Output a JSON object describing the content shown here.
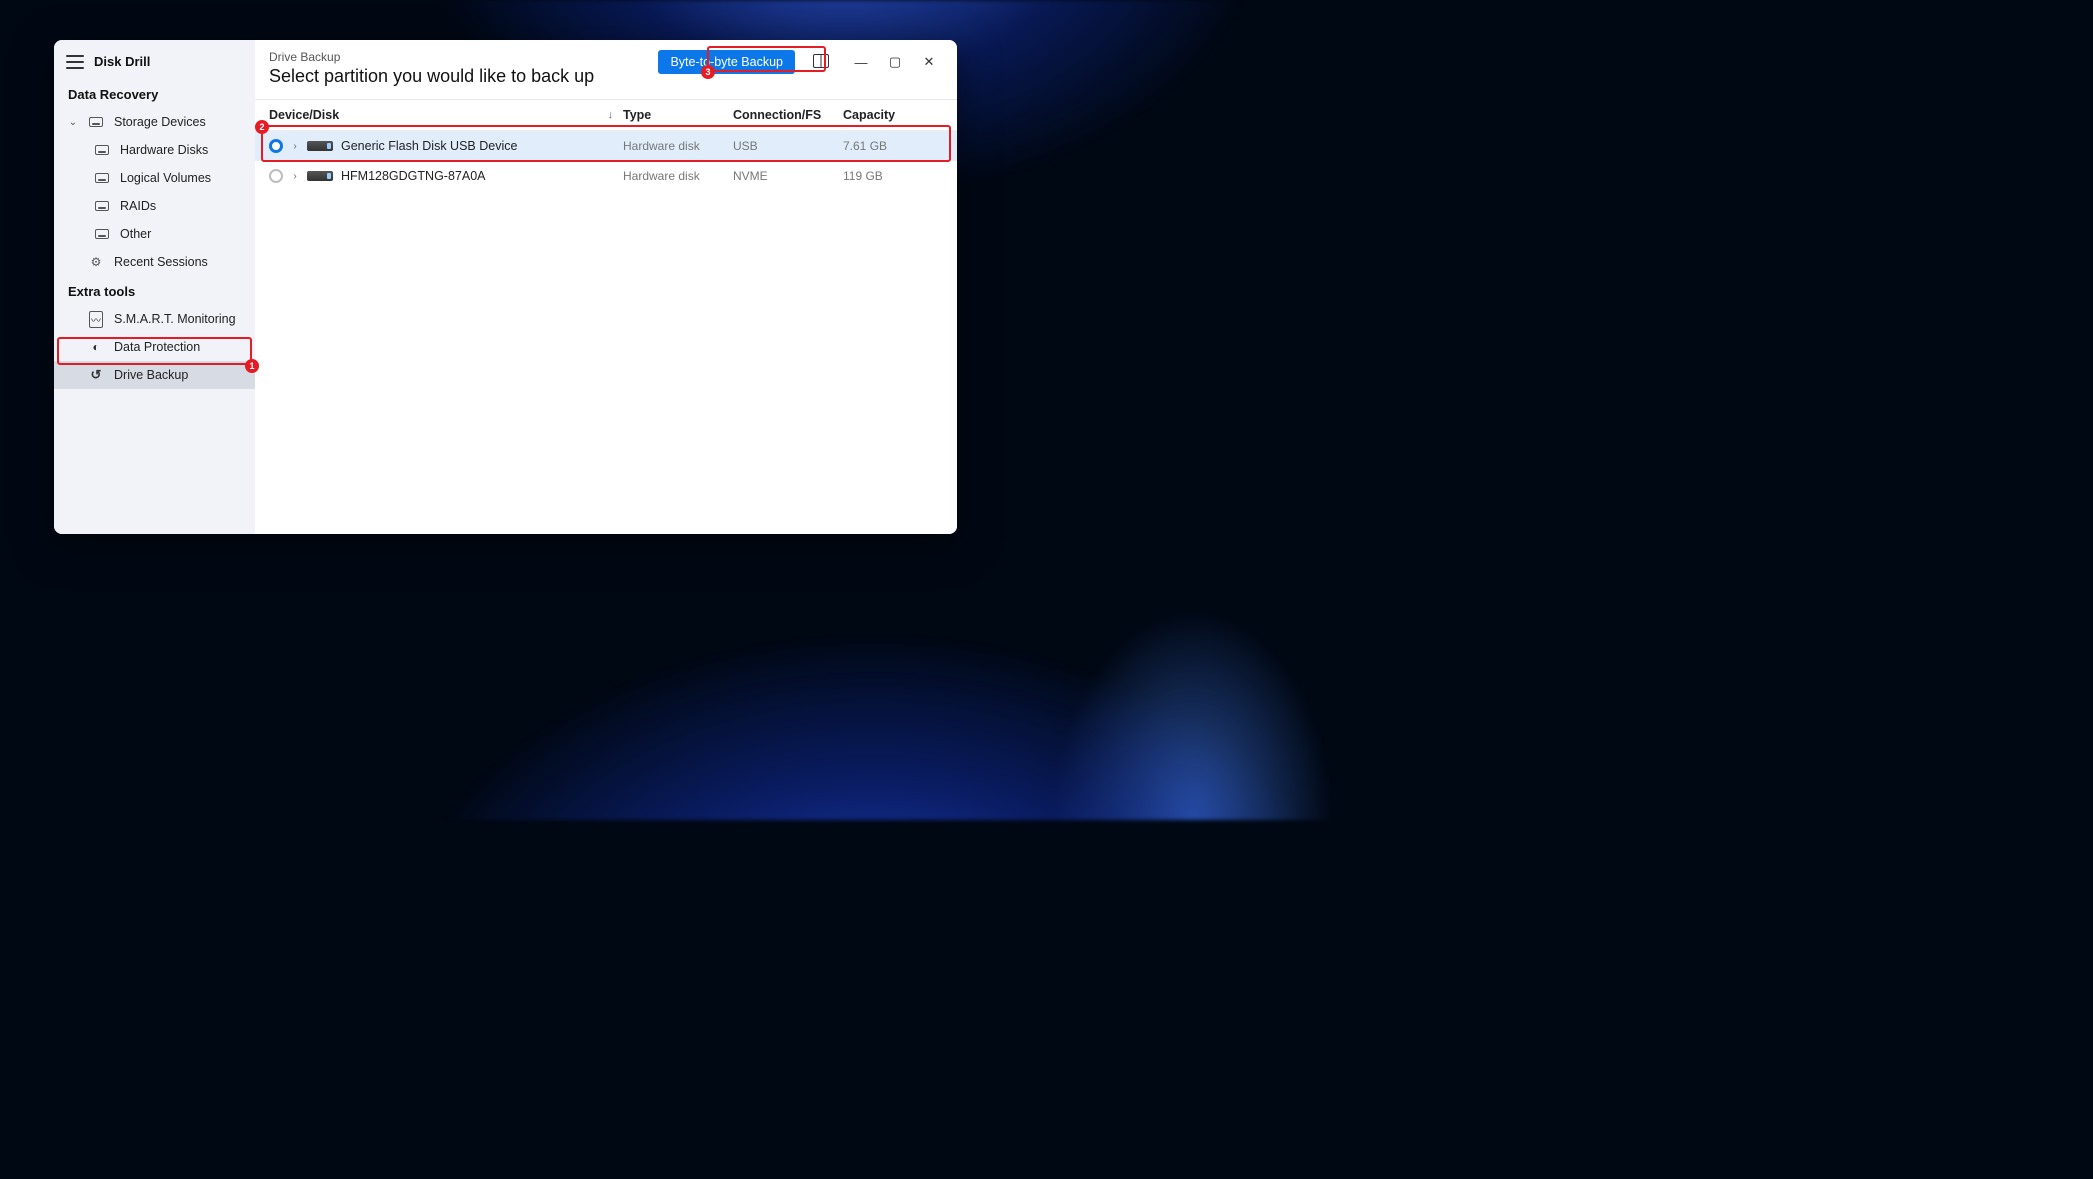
{
  "app": {
    "title": "Disk Drill"
  },
  "sidebar": {
    "sections": [
      {
        "label": "Data Recovery",
        "items": [
          {
            "label": "Storage Devices",
            "expandable": true
          },
          {
            "label": "Hardware Disks"
          },
          {
            "label": "Logical Volumes"
          },
          {
            "label": "RAIDs"
          },
          {
            "label": "Other"
          },
          {
            "label": "Recent Sessions"
          }
        ]
      },
      {
        "label": "Extra tools",
        "items": [
          {
            "label": "S.M.A.R.T. Monitoring"
          },
          {
            "label": "Data Protection"
          },
          {
            "label": "Drive Backup",
            "active": true
          }
        ]
      }
    ]
  },
  "header": {
    "breadcrumb": "Drive Backup",
    "title": "Select partition you would like to back up",
    "primary_button": "Byte-to-byte Backup"
  },
  "table": {
    "columns": {
      "device": "Device/Disk",
      "type": "Type",
      "connection": "Connection/FS",
      "capacity": "Capacity"
    },
    "sort_indicator": "↓",
    "rows": [
      {
        "selected": true,
        "name": "Generic Flash Disk USB Device",
        "type": "Hardware disk",
        "connection": "USB",
        "capacity": "7.61 GB"
      },
      {
        "selected": false,
        "name": "HFM128GDGTNG-87A0A",
        "type": "Hardware disk",
        "connection": "NVME",
        "capacity": "119 GB"
      }
    ]
  },
  "annotations": {
    "1": "1",
    "2": "2",
    "3": "3"
  }
}
